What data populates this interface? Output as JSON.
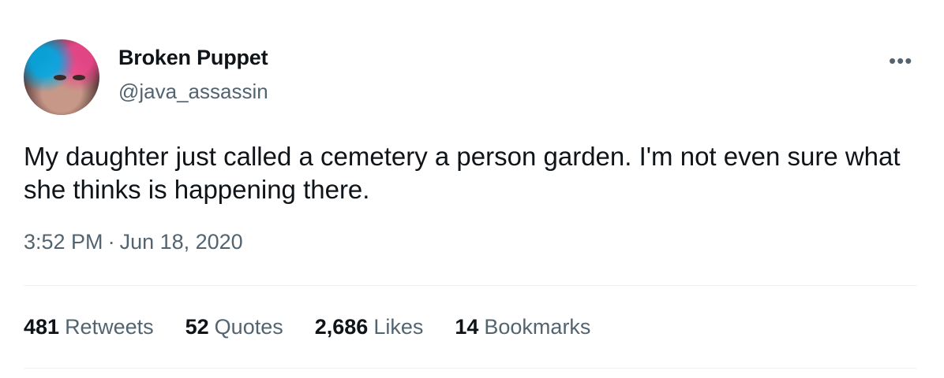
{
  "tweet": {
    "display_name": "Broken Puppet",
    "handle": "@java_assassin",
    "more_label": "•••",
    "text": "My daughter just called a cemetery a person garden. I'm not even sure what she thinks is happening there.",
    "time": "3:52 PM",
    "separator": "·",
    "date": "Jun 18, 2020"
  },
  "stats": [
    {
      "count": "481",
      "label": "Retweets"
    },
    {
      "count": "52",
      "label": "Quotes"
    },
    {
      "count": "2,686",
      "label": "Likes"
    },
    {
      "count": "14",
      "label": "Bookmarks"
    }
  ],
  "colors": {
    "text": "#0f1419",
    "secondary": "#536471",
    "divider": "#eff3f4"
  }
}
